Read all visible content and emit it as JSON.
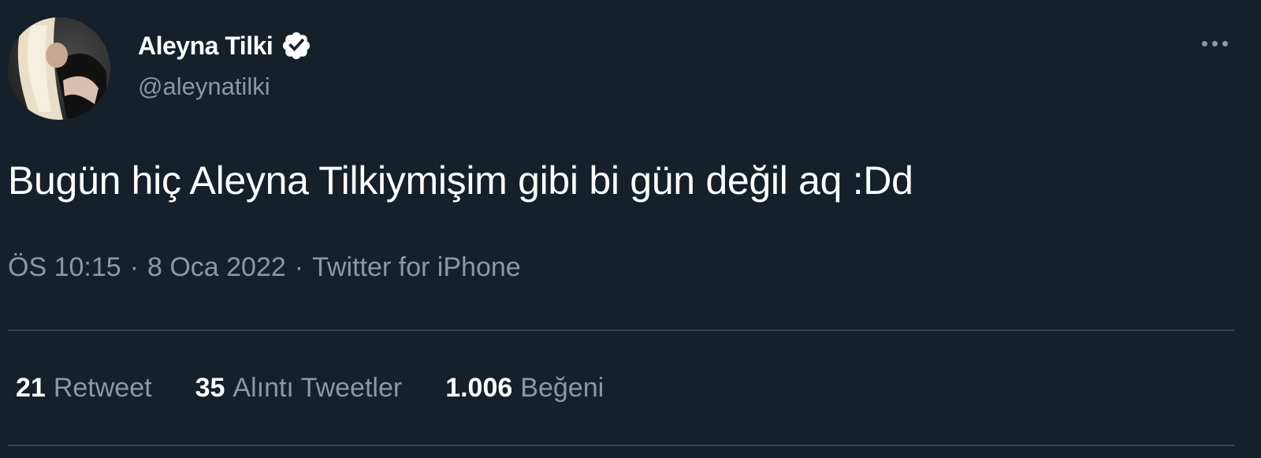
{
  "user": {
    "display_name": "Aleyna Tilki",
    "handle": "@aleynatilki",
    "verified": true
  },
  "tweet": {
    "text": "Bugün hiç Aleyna Tilkiymişim gibi bi gün değil aq :Dd",
    "time": "ÖS 10:15",
    "separator1": "·",
    "date": "8 Oca 2022",
    "separator2": "·",
    "source": "Twitter for iPhone"
  },
  "stats": {
    "retweets": {
      "count": "21",
      "label": "Retweet"
    },
    "quotes": {
      "count": "35",
      "label": "Alıntı Tweetler"
    },
    "likes": {
      "count": "1.006",
      "label": "Beğeni"
    }
  },
  "colors": {
    "background": "#15202b",
    "text_primary": "#ffffff",
    "text_secondary": "#8b98a5",
    "divider": "#38444d"
  },
  "icons": {
    "verified": "verified-badge-icon",
    "more": "more-horizontal-icon"
  }
}
